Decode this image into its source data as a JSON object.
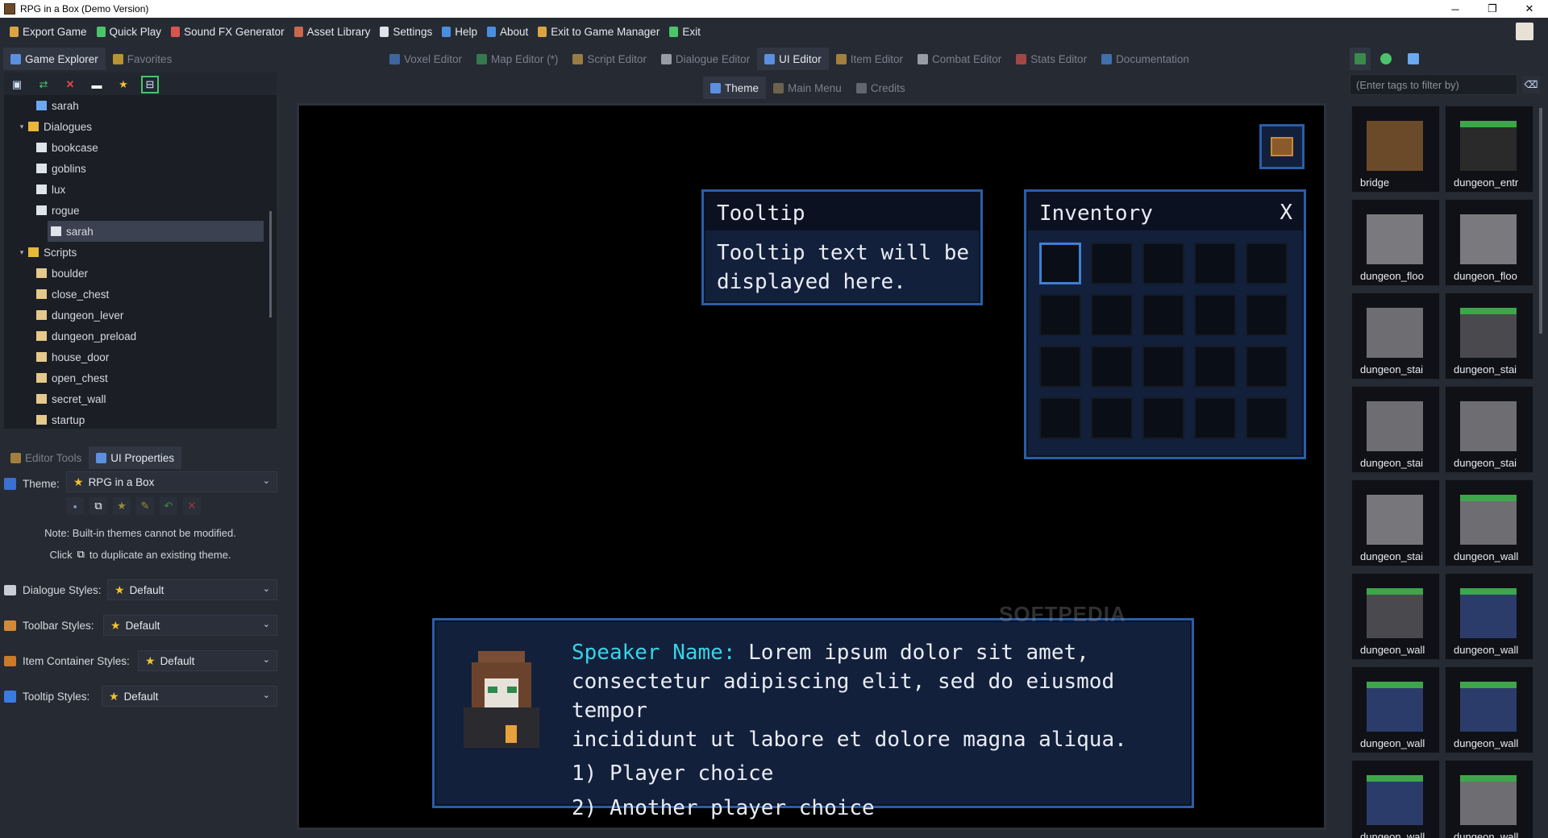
{
  "window": {
    "title": "RPG in a Box (Demo Version)",
    "buttons": [
      "─",
      "❐",
      "✕"
    ]
  },
  "menu": [
    {
      "label": "Export Game",
      "icon": "export-icon",
      "color": "#d9a441"
    },
    {
      "label": "Quick Play",
      "icon": "play-icon",
      "color": "#4bc46a"
    },
    {
      "label": "Sound FX Generator",
      "icon": "sound-icon",
      "color": "#d9544f"
    },
    {
      "label": "Asset Library",
      "icon": "library-icon",
      "color": "#c9684a"
    },
    {
      "label": "Settings",
      "icon": "settings-icon",
      "color": "#dfe3ea"
    },
    {
      "label": "Help",
      "icon": "help-icon",
      "color": "#4a8ee0"
    },
    {
      "label": "About",
      "icon": "about-icon",
      "color": "#4a8ee0"
    },
    {
      "label": "Exit to Game Manager",
      "icon": "exit-manager-icon",
      "color": "#d9a441"
    },
    {
      "label": "Exit",
      "icon": "exit-icon",
      "color": "#4bc46a"
    }
  ],
  "leftTabs": [
    {
      "label": "Game Explorer",
      "icon": "explorer-icon",
      "active": true
    },
    {
      "label": "Favorites",
      "icon": "star-icon",
      "active": false
    }
  ],
  "editorTabs": [
    {
      "label": "Voxel Editor",
      "icon": "voxel-icon",
      "active": false
    },
    {
      "label": "Map Editor (*)",
      "icon": "map-icon",
      "active": false
    },
    {
      "label": "Script Editor",
      "icon": "script-icon",
      "active": false
    },
    {
      "label": "Dialogue Editor",
      "icon": "dialogue-icon",
      "active": false
    },
    {
      "label": "UI Editor",
      "icon": "ui-icon",
      "active": true
    },
    {
      "label": "Item Editor",
      "icon": "item-icon",
      "active": false
    },
    {
      "label": "Combat Editor",
      "icon": "combat-icon",
      "active": false
    },
    {
      "label": "Stats Editor",
      "icon": "stats-icon",
      "active": false
    },
    {
      "label": "Documentation",
      "icon": "docs-icon",
      "active": false
    }
  ],
  "subTabs": [
    {
      "label": "Theme",
      "active": true
    },
    {
      "label": "Main Menu",
      "active": false
    },
    {
      "label": "Credits",
      "active": false
    }
  ],
  "tree": [
    {
      "label": "sarah",
      "type": "character",
      "depth": 2
    },
    {
      "label": "Dialogues",
      "type": "folder",
      "depth": 1
    },
    {
      "label": "bookcase",
      "type": "dialogue",
      "depth": 2
    },
    {
      "label": "goblins",
      "type": "dialogue",
      "depth": 2
    },
    {
      "label": "lux",
      "type": "dialogue",
      "depth": 2
    },
    {
      "label": "rogue",
      "type": "dialogue",
      "depth": 2
    },
    {
      "label": "sarah",
      "type": "dialogue",
      "depth": 2,
      "selected": true
    },
    {
      "label": "Scripts",
      "type": "folder",
      "depth": 1
    },
    {
      "label": "boulder",
      "type": "script",
      "depth": 2
    },
    {
      "label": "close_chest",
      "type": "script",
      "depth": 2
    },
    {
      "label": "dungeon_lever",
      "type": "script",
      "depth": 2
    },
    {
      "label": "dungeon_preload",
      "type": "script",
      "depth": 2
    },
    {
      "label": "house_door",
      "type": "script",
      "depth": 2
    },
    {
      "label": "open_chest",
      "type": "script",
      "depth": 2
    },
    {
      "label": "secret_wall",
      "type": "script",
      "depth": 2
    },
    {
      "label": "startup",
      "type": "script",
      "depth": 2
    }
  ],
  "bottomTabs": [
    {
      "label": "Editor Tools",
      "active": false
    },
    {
      "label": "UI Properties",
      "active": true
    }
  ],
  "theme": {
    "label": "Theme:",
    "value": "RPG in a Box"
  },
  "notes": {
    "line1": "Note: Built-in themes cannot be modified.",
    "click": "Click",
    "line2": "to duplicate an existing theme."
  },
  "styles": {
    "dialogue": {
      "label": "Dialogue Styles:",
      "value": "Default"
    },
    "toolbar": {
      "label": "Toolbar Styles:",
      "value": "Default"
    },
    "itemContainer": {
      "label": "Item Container Styles:",
      "value": "Default"
    },
    "tooltip": {
      "label": "Tooltip Styles:",
      "value": "Default"
    }
  },
  "preview": {
    "tooltipTitle": "Tooltip",
    "tooltipText1": "Tooltip text will be",
    "tooltipText2": "displayed here.",
    "inventoryTitle": "Inventory",
    "inventoryClose": "X",
    "speaker": "Speaker Name:",
    "line1": "Lorem ipsum dolor sit amet,",
    "line2": "consectetur adipiscing elit, sed do eiusmod tempor",
    "line3": "incididunt ut labore et dolore magna aliqua.",
    "choice1": "1) Player choice",
    "choice2": "2) Another player choice",
    "watermark": "SOFTPEDIA"
  },
  "assetFilter": {
    "placeholder": "(Enter tags to filter by)"
  },
  "assets": [
    "bridge",
    "dungeon_entr",
    "dungeon_floo",
    "dungeon_floo",
    "dungeon_stai",
    "dungeon_stai",
    "dungeon_stai",
    "dungeon_stai",
    "dungeon_stai",
    "dungeon_wall",
    "dungeon_wall",
    "dungeon_wall",
    "dungeon_wall",
    "dungeon_wall",
    "dungeon_wall",
    "dungeon_wall"
  ]
}
